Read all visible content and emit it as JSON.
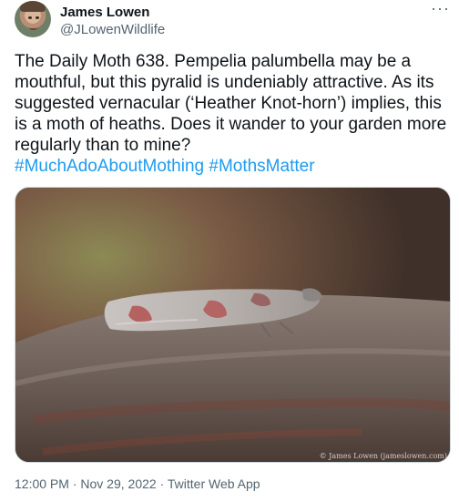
{
  "author": {
    "name": "James Lowen",
    "handle": "@JLowenWildlife"
  },
  "menu_icon": "ellipsis-icon",
  "tweet": {
    "text": "The Daily Moth 638. Pempelia palumbella may be a mouthful, but this pyralid is undeniably attractive. As its suggested vernacular (‘Heather Knot-horn’) implies, this is a moth of heaths. Does it wander to your garden more regularly than to mine?",
    "hashtags": [
      "#MuchAdoAboutMothing",
      "#MothsMatter"
    ]
  },
  "media": {
    "watermark": "© James Lowen (jameslowen.com)"
  },
  "meta": {
    "time": "12:00 PM",
    "date": "Nov 29, 2022",
    "source": "Twitter Web App",
    "separator": " · "
  }
}
